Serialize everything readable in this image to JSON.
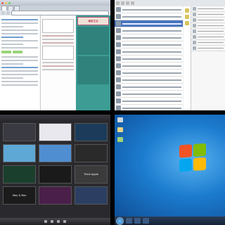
{
  "panes": {
    "browser": {
      "sidebar_ad_text": "最新生活"
    },
    "wallpaper_picker": {
      "thumbnails": [
        {
          "label": "",
          "color": "#3a3a42"
        },
        {
          "label": "",
          "color": "#e8e8ee"
        },
        {
          "label": "",
          "color": "#1c3b5a"
        },
        {
          "label": "",
          "color": "#5ea8d6"
        },
        {
          "label": "",
          "color": "#4f8ed0"
        },
        {
          "label": "",
          "color": "#2a2a2a"
        },
        {
          "label": "",
          "color": "#1a3f2d"
        },
        {
          "label": "",
          "color": "#1a1a1a"
        },
        {
          "label": "Think Apple",
          "color": "#3b3b3b"
        },
        {
          "label": "Stay & Mac",
          "color": "#1b1b1b"
        },
        {
          "label": "",
          "color": "#4a1f4a"
        },
        {
          "label": "",
          "color": "#2c3f63"
        }
      ]
    },
    "windows7": {
      "taskbar_clock": ""
    }
  },
  "colors": {
    "win_red": "#f35325",
    "win_green": "#81bc06",
    "win_blue": "#05a6f0",
    "win_yellow": "#ffba08"
  }
}
